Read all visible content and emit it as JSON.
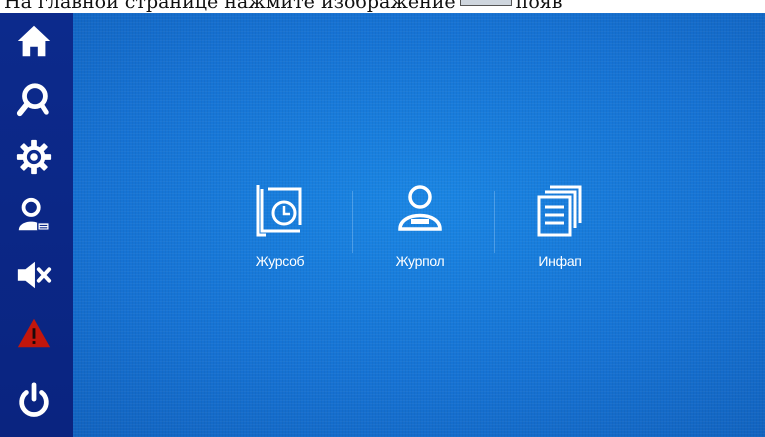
{
  "caption": {
    "text_before": "На главной странице нажмите изображение",
    "text_after": "появ"
  },
  "sidebar": {
    "items": [
      {
        "name": "home",
        "icon": "home-icon"
      },
      {
        "name": "search",
        "icon": "search-icon"
      },
      {
        "name": "settings",
        "icon": "gear-icon"
      },
      {
        "name": "user",
        "icon": "user-icon"
      },
      {
        "name": "mute",
        "icon": "mute-icon"
      },
      {
        "name": "alarm",
        "icon": "warning-icon"
      },
      {
        "name": "power",
        "icon": "power-icon"
      }
    ]
  },
  "main": {
    "tiles": [
      {
        "label": "Журсоб",
        "icon": "event-log-icon"
      },
      {
        "label": "Журпол",
        "icon": "user-log-icon"
      },
      {
        "label": "Инфап",
        "icon": "device-info-icon"
      }
    ]
  },
  "colors": {
    "background": "#1672d3",
    "sidebar": "#0c2a8c",
    "icon": "#ffffff",
    "warning": "#c2160c"
  }
}
